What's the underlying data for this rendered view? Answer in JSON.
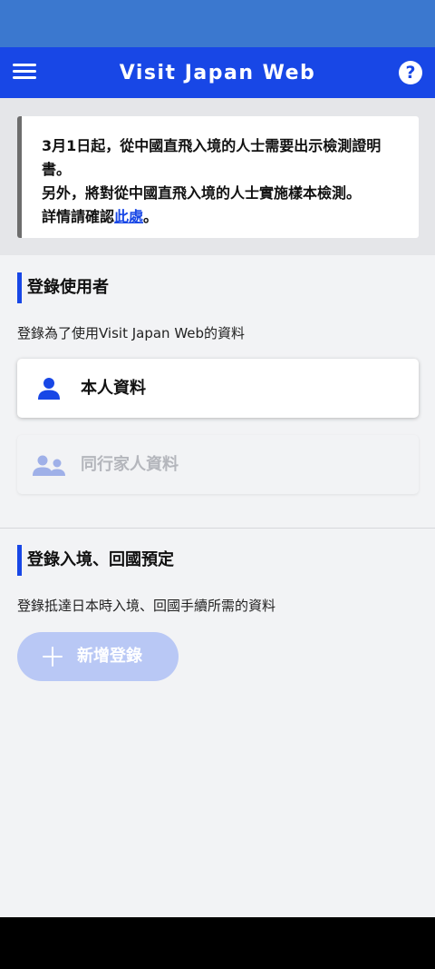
{
  "app_bar": {
    "title": "Visit Japan Web",
    "help_label": "?"
  },
  "notice": {
    "line1": "3月1日起，從中國直飛入境的人士需要出示檢測證明書。",
    "line2": "另外，將對從中國直飛入境的人士實施樣本檢測。",
    "line3_prefix": "詳情請確認",
    "line3_link": "此處",
    "line3_suffix": "。"
  },
  "user_section": {
    "title": "登錄使用者",
    "description": "登錄為了使用Visit Japan Web的資料",
    "my_info_label": "本人資料",
    "family_info_label": "同行家人資料"
  },
  "entry_section": {
    "title": "登錄入境、回國預定",
    "description": "登錄抵達日本時入境、回國手續所需的資料",
    "add_button_label": "新增登錄"
  },
  "colors": {
    "status_bar": "#3b78cf",
    "app_bar": "#1847e6",
    "accent": "#1847e6",
    "disabled_icon": "#9fb0e8",
    "add_button": "#b9c8f5"
  }
}
